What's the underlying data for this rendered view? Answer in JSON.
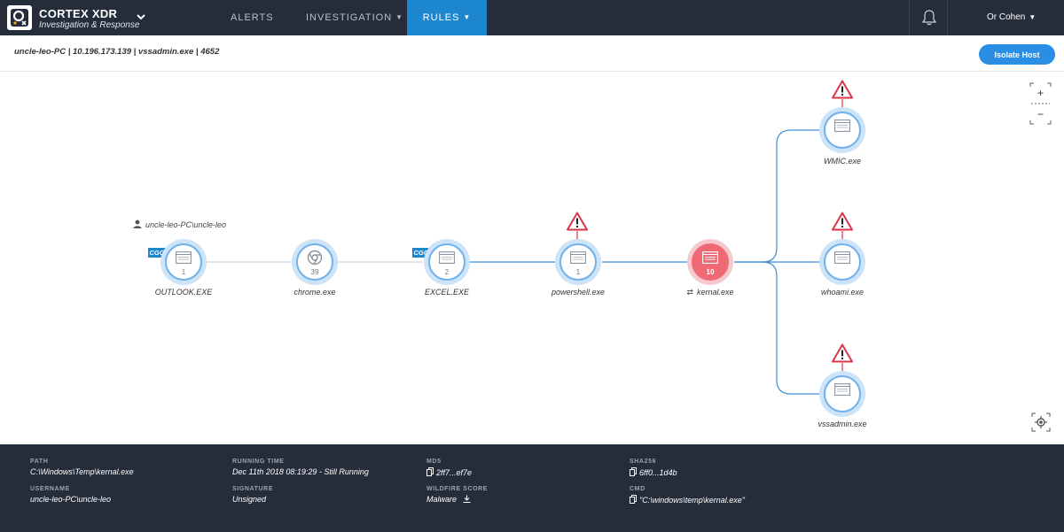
{
  "app": {
    "name": "CORTEX XDR",
    "subtitle": "Investigation & Response"
  },
  "nav": {
    "alerts": "ALERTS",
    "investigation": "INVESTIGATION",
    "rules": "RULES"
  },
  "user": {
    "name": "Or Cohen"
  },
  "host": {
    "info": "uncle-leo-PC | 10.196.173.139 | vssadmin.exe | 4652",
    "isolate_label": "Isolate Host"
  },
  "graph": {
    "user_label": "uncle-leo-PC\\uncle-leo",
    "badge_text": "CGO",
    "nodes": [
      {
        "name": "OUTLOOK.EXE",
        "count": "1",
        "cgo": true
      },
      {
        "name": "chrome.exe",
        "count": "39"
      },
      {
        "name": "EXCEL.EXE",
        "count": "2",
        "cgo": true
      },
      {
        "name": "powershell.exe",
        "count": "1",
        "alert": true
      },
      {
        "name": "kernal.exe",
        "count": "10",
        "selected": true
      },
      {
        "name": "WMIC.exe",
        "alert": true
      },
      {
        "name": "whoami.exe",
        "alert": true
      },
      {
        "name": "vssadmin.exe",
        "alert": true
      }
    ],
    "zoom": {
      "plus": "+",
      "minus": "−"
    }
  },
  "details": {
    "path_label": "PATH",
    "path": "C:\\Windows\\Temp\\kernal.exe",
    "username_label": "USERNAME",
    "username": "uncle-leo-PC\\uncle-leo",
    "running_label": "RUNNING TIME",
    "running": "Dec 11th 2018 08:19:29 - Still Running",
    "signature_label": "SIGNATURE",
    "signature": "Unsigned",
    "md5_label": "MD5",
    "md5": "2ff7...ef7e",
    "wildfire_label": "WILDFIRE SCORE",
    "wildfire": "Malware",
    "sha_label": "SHA256",
    "sha": "6ff0...1d4b",
    "cmd_label": "CMD",
    "cmd": "\"C:\\windows\\temp\\kernal.exe\""
  },
  "colors": {
    "nav_bg": "#252c3a",
    "accent": "#1c86cf",
    "node_ring": "#6fb1ea",
    "selected_node": "#ef6a74",
    "alert": "#d9364a"
  }
}
